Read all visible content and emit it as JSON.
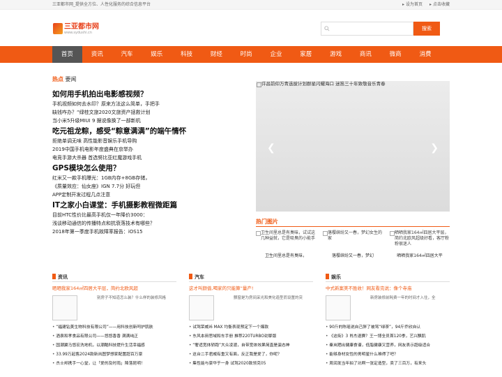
{
  "topbar": {
    "tagline": "三亚都市网_提供全方位、人性化服务的综合信息平台",
    "set_home": "设为首页",
    "favorite": "点击收藏"
  },
  "header": {
    "logo_cn": "三亚都市网",
    "logo_en": "www.sydushi.cn",
    "search_placeholder": "",
    "search_button": "搜索"
  },
  "nav": [
    "首页",
    "资讯",
    "汽车",
    "娱乐",
    "科技",
    "财经",
    "时尚",
    "企业",
    "家居",
    "游戏",
    "商讯",
    "微商",
    "消费"
  ],
  "hot": {
    "label_hot": "热点",
    "label_news": "要闻"
  },
  "topics": [
    {
      "title": "如何用手机拍出电影感视频？",
      "items": [
        "手机视频如何去水印？原来方法这么简单，手把手",
        "缺钱咋办？“绿桂文旅2020文旅资产拯救计划",
        "当小米5升级MIUI 9 据说像换了一部新机"
      ]
    },
    {
      "title": "吃元祖龙粽，感受“粽意满满”的端午情怀",
      "items": [
        "拒绝单调无味 高性能影音娱乐手机导购",
        "2019中国手机电影年度盛典在京举办",
        "电竞手游大杀器 首选努比亚红魔游戏手机"
      ]
    },
    {
      "title": "GPS模块怎么使用？",
      "items": [
        "红米又一款手机曝光：1GB内存+8GB存储，",
        "《质量效应：仙女座》IGN 7.7分 好玩但",
        "APP定制开发过程几点注意"
      ]
    },
    {
      "title": "IT之家小白课堂：手机摄影教程微距篇",
      "items": [
        "目前HTC性价比最高手机仅一年降价3000：",
        "浅谈移动通信的传播特点和抗衰落技术有哪些？",
        "2018年第一季度手机故障率报告：iOS15"
      ]
    }
  ],
  "slider": {
    "caption": "许昌前仰万青选拔计划群星闪耀海口 迷笛三十年致敬音乐青春"
  },
  "pictures": {
    "title": "热门图片",
    "items": [
      {
        "alt": "卫生间里总是有臭味，试试这几种益就，它是吸臭的小能手",
        "caption": "卫生间里总是有臭味，"
      },
      {
        "alt": "落樱缤纷又一春，梦幻女生的家",
        "caption": "落樱缤纷又一春，梦幻"
      },
      {
        "alt": "晒晒我家164㎡四居大平层，简约北欧风超级好看，客厅粉粉很迷人",
        "caption": "晒晒我家164㎡四居大平"
      }
    ]
  },
  "columns": [
    {
      "name": "资讯",
      "lead": "晒晒我家164㎡四居大平层，简约北欧风超",
      "desc": "别房子不知道怎么装？什么样的装修风格",
      "items": [
        "“福建钻美生物科技有限公司”——用科技创新呵护肌肤",
        "酒泉和孝食品有限公司——悠悠香香 满满纯正",
        "国潮翼马悠宏洗地机，以潮酷科技提升生活幸福感",
        "33.99万起售2024款新岚图梦想家配置超百万豪",
        "杰士邦携手一心堂，让「爱的及时雨」降落昆明！"
      ]
    },
    {
      "name": "汽车",
      "lead": "这才叫颜值,喝家的只能算“量产!",
      "desc": "颤窗是为房间采光和美化造型而设置的突",
      "items": [
        "试驾荣威i6 MAX 均衡表现预定下一个爆款",
        "东风本田思域和车手册 推荐220TURBO劲擎版",
        "“奢适宽体轿跑”大众凌渡，自带宽体效果简直是姿态神",
        "这台二手君威有重又有面，反正我是爱了，你呢？",
        "集性能与豪华于一身 试驾2020款领克05"
      ]
    },
    {
      "name": "娱乐",
      "lead": "中式新案美不胜收！网友看完说：像个寺庙",
      "desc": "新房装修前耗费一年的时间才入住，全",
      "items": [
        "90斤的陈瑶说自己胖了被骂“绿茶”，94斤乔欣自认",
        "《这街》3 肖杰退赛？王一博全员首120季，艺兴飘肌",
        "秦岚晒出健康食谱，低脂健康又营养，网友表示超级适合",
        "能够身材女性的男明星什么难得了吧？",
        "周润发当年拍了坑啊一张定造型，卖了三百万，有来头"
      ]
    }
  ]
}
